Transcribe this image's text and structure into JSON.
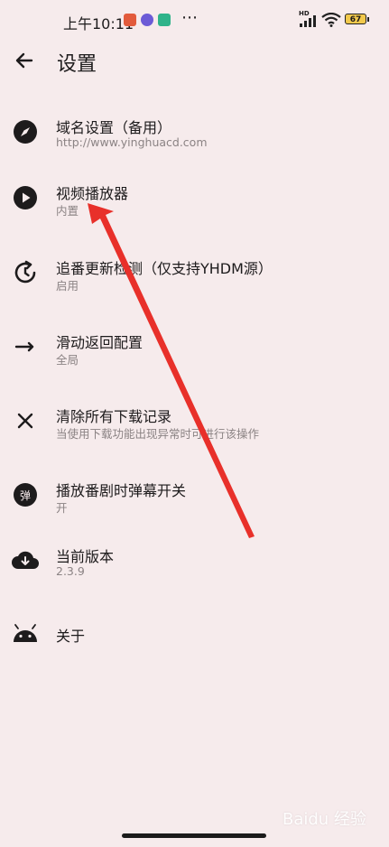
{
  "status_bar": {
    "time": "上午10:11",
    "network": "HD",
    "battery": "67"
  },
  "app_bar": {
    "title": "设置"
  },
  "settings": [
    {
      "title": "域名设置（备用）",
      "subtitle": "http://www.yinghuacd.com",
      "icon": "compass-icon"
    },
    {
      "title": "视频播放器",
      "subtitle": "内置",
      "icon": "play-circle-icon"
    },
    {
      "title": "追番更新检测（仅支持YHDM源）",
      "subtitle": "启用",
      "icon": "refresh-clock-icon"
    },
    {
      "title": "滑动返回配置",
      "subtitle": "全局",
      "icon": "arrow-right-icon"
    },
    {
      "title": "清除所有下载记录",
      "subtitle": "当使用下载功能出现异常时可进行该操作",
      "icon": "close-icon"
    },
    {
      "title": "播放番剧时弹幕开关",
      "subtitle": "开",
      "icon": "danmaku-icon",
      "icon_text": "弹"
    },
    {
      "title": "当前版本",
      "subtitle": "2.3.9",
      "icon": "cloud-download-icon"
    },
    {
      "title": "关于",
      "subtitle": "",
      "icon": "android-icon"
    }
  ],
  "colors": {
    "background": "#f6ebec",
    "annotation_arrow": "#e8302a"
  },
  "watermark": "Baidu 经验"
}
